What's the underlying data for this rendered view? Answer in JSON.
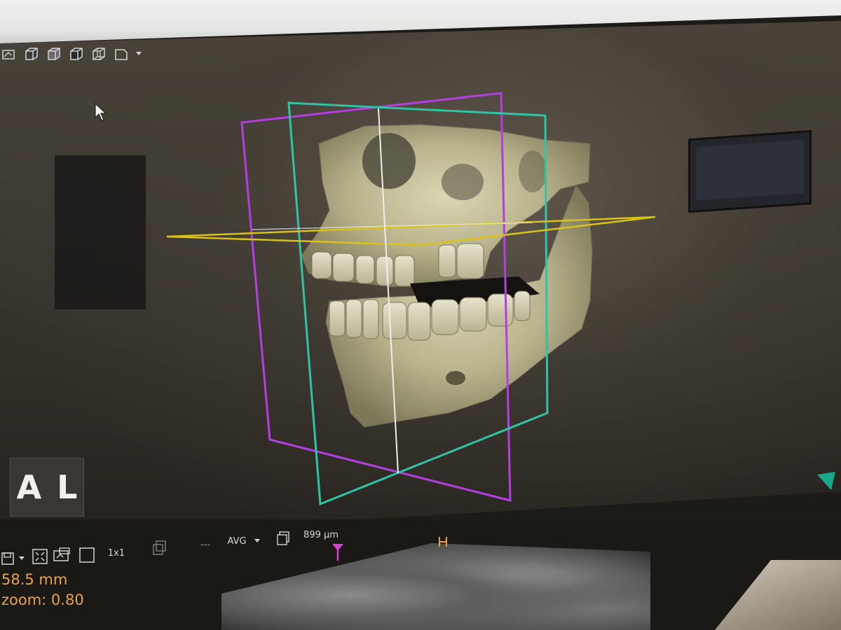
{
  "viewer": {
    "orientation_left": "A",
    "orientation_right": "L",
    "toolbar_3d": {
      "icons": [
        "view-reset-icon",
        "cube-solid-icon",
        "cube-shaded-icon",
        "cube-outline-icon",
        "cube-wire-icon",
        "cube-face-icon",
        "dropdown-arrow-icon"
      ]
    }
  },
  "lower_toolbar": {
    "layout_label": "1x1",
    "separator": "---",
    "projection_mode": "AVG",
    "slice_thickness": "899 µm",
    "icons": [
      "save-icon",
      "dropdown-arrow-icon",
      "fit-screen-icon",
      "screenshot-icon",
      "single-layout-icon",
      "copy-icon",
      "slab-icon",
      "crosshair-marker-icon",
      "position-marker-icon"
    ]
  },
  "measurements": {
    "distance": "58.5 mm",
    "zoom": "zoom: 0.80"
  },
  "colors": {
    "sagittal_plane": "#b43ee0",
    "coronal_plane": "#2ec4a6",
    "axial_plane": "#d9c21a",
    "accent_measure": "#e8a24a",
    "marker_magenta": "#d63fd0",
    "corner_indicator": "#1aa88a"
  }
}
